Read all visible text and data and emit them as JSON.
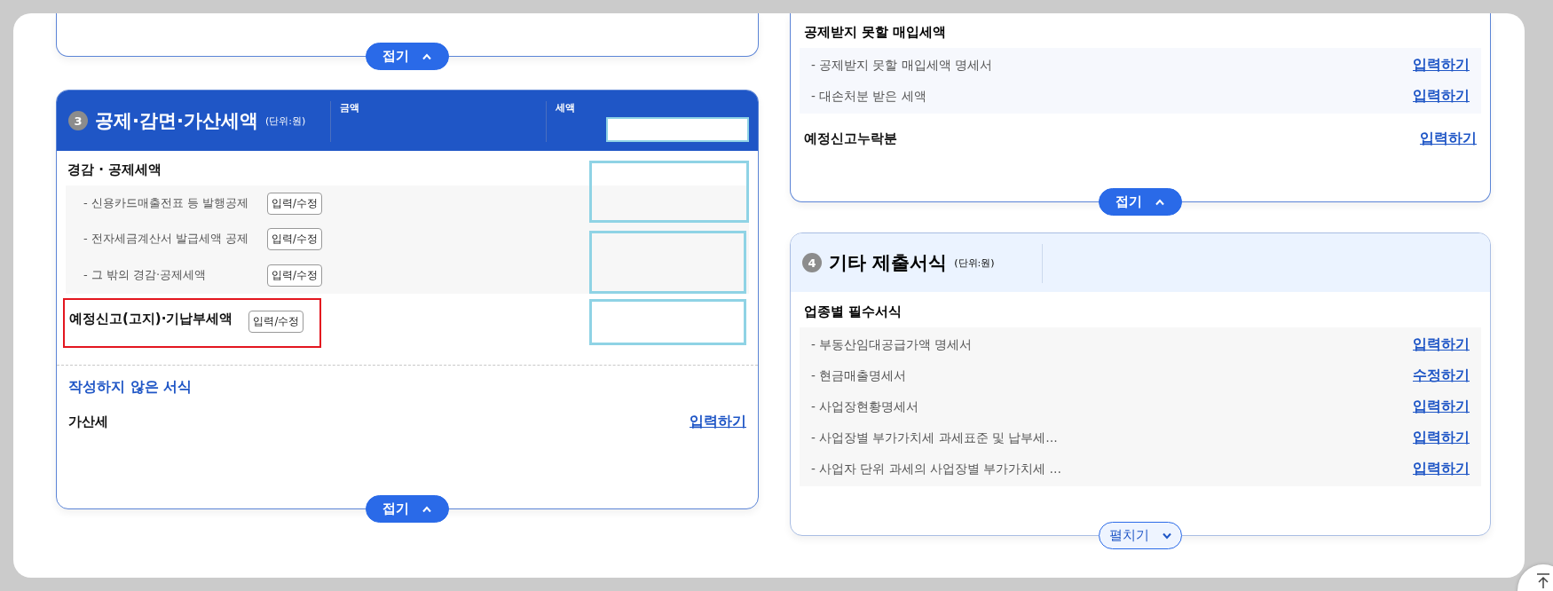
{
  "left": {
    "top_card": {
      "fold_button": {
        "label": "접기",
        "expanded": true
      }
    },
    "deduction_card": {
      "number": "3",
      "title": "공제·감면·가산세액",
      "unit": "(단위:원)",
      "columns": [
        "금액",
        "세액"
      ],
      "group_title": "경감 · 공제세액",
      "items": [
        {
          "label": "- 신용카드매출전표 등 발행공제",
          "button": "입력/수정"
        },
        {
          "label": "- 전자세금계산서 발급세액 공제",
          "button": "입력/수정"
        },
        {
          "label": "- 그 밖의 경감·공제세액",
          "button": "입력/수정"
        }
      ],
      "main_row": {
        "label": "예정신고(고지)·기납부세액",
        "button": "입력/수정",
        "highlighted": true
      },
      "unfilled_heading": "작성하지 않은 서식",
      "unfilled_rows": [
        {
          "label": "가산세",
          "link": "입력하기"
        }
      ],
      "fold_button": {
        "label": "접기",
        "expanded": true
      }
    }
  },
  "right": {
    "purchase_card": {
      "group_title": "공제받지 못할 매입세액",
      "items": [
        {
          "label": "- 공제받지 못할 매입세액 명세서",
          "link": "입력하기"
        },
        {
          "label": "- 대손처분 받은 세액",
          "link": "입력하기"
        }
      ],
      "rows": [
        {
          "label": "예정신고누락분",
          "link": "입력하기"
        }
      ],
      "fold_button": {
        "label": "접기",
        "expanded": true
      }
    },
    "other_forms_card": {
      "number": "4",
      "title": "기타 제출서식",
      "unit": "(단위:원)",
      "group_title": "업종별 필수서식",
      "items": [
        {
          "label": "- 부동산임대공급가액 명세서",
          "link": "입력하기"
        },
        {
          "label": "- 현금매출명세서",
          "link": "수정하기"
        },
        {
          "label": "- 사업장현황명세서",
          "link": "입력하기"
        },
        {
          "label": "- 사업장별 부가가치세 과세표준 및 납부세…",
          "link": "입력하기"
        },
        {
          "label": "- 사업자 단위 과세의 사업장별 부가가치세 …",
          "link": "입력하기"
        }
      ],
      "fold_button": {
        "label": "펼치기",
        "expanded": false
      }
    }
  }
}
